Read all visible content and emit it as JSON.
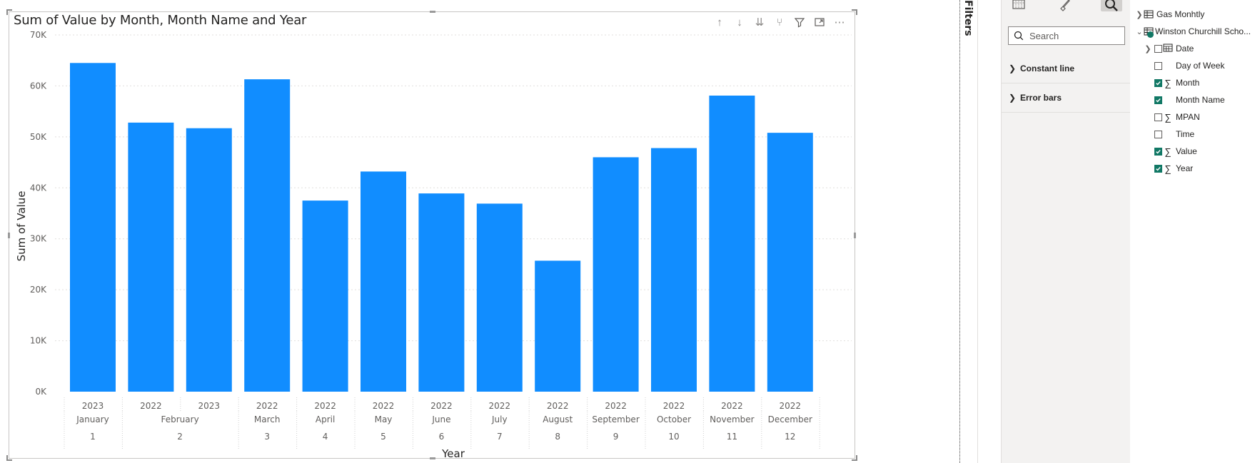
{
  "visual": {
    "title": "Sum of Value by Month, Month Name and Year",
    "toolbar": {
      "drill_up": "↑",
      "drill_down": "↓",
      "next_level": "⇊",
      "expand": "⑂",
      "filter": "filter-icon",
      "focus": "focus-mode-icon",
      "more": "⋯"
    }
  },
  "chart_data": {
    "type": "bar",
    "title": "Sum of Value by Month, Month Name and Year",
    "xlabel": "Year",
    "ylabel": "Sum of Value",
    "ylim": [
      0,
      70000
    ],
    "y_ticks": [
      "0K",
      "10K",
      "20K",
      "30K",
      "40K",
      "50K",
      "60K",
      "70K"
    ],
    "grid": true,
    "bar_color": "#118dff",
    "categories": [
      {
        "year": "2023",
        "month_name": "January",
        "month": "1"
      },
      {
        "year": "2022",
        "month_name": "February",
        "month": "2"
      },
      {
        "year": "2023",
        "month_name": "February",
        "month": "2"
      },
      {
        "year": "2022",
        "month_name": "March",
        "month": "3"
      },
      {
        "year": "2022",
        "month_name": "April",
        "month": "4"
      },
      {
        "year": "2022",
        "month_name": "May",
        "month": "5"
      },
      {
        "year": "2022",
        "month_name": "June",
        "month": "6"
      },
      {
        "year": "2022",
        "month_name": "July",
        "month": "7"
      },
      {
        "year": "2022",
        "month_name": "August",
        "month": "8"
      },
      {
        "year": "2022",
        "month_name": "September",
        "month": "9"
      },
      {
        "year": "2022",
        "month_name": "October",
        "month": "10"
      },
      {
        "year": "2022",
        "month_name": "November",
        "month": "11"
      },
      {
        "year": "2022",
        "month_name": "December",
        "month": "12"
      }
    ],
    "values": [
      64500,
      52800,
      51700,
      61300,
      37500,
      43200,
      38900,
      36900,
      25700,
      46000,
      47800,
      58100,
      50800
    ]
  },
  "filters_pane": {
    "label": "Filters"
  },
  "viz_pane": {
    "search_placeholder": "Search",
    "sections": [
      {
        "label": "Constant line"
      },
      {
        "label": "Error bars"
      }
    ]
  },
  "fields_pane": {
    "tables": [
      {
        "name": "Gas Monhtly"
      },
      {
        "name": "Winston Churchill Scho..."
      }
    ],
    "fields": [
      {
        "name": "Date",
        "checked": false,
        "type": "date"
      },
      {
        "name": "Day of Week",
        "checked": false,
        "type": "text"
      },
      {
        "name": "Month",
        "checked": true,
        "type": "sum"
      },
      {
        "name": "Month Name",
        "checked": true,
        "type": "text"
      },
      {
        "name": "MPAN",
        "checked": false,
        "type": "sum"
      },
      {
        "name": "Time",
        "checked": false,
        "type": "text"
      },
      {
        "name": "Value",
        "checked": true,
        "type": "sum"
      },
      {
        "name": "Year",
        "checked": true,
        "type": "sum"
      }
    ]
  }
}
